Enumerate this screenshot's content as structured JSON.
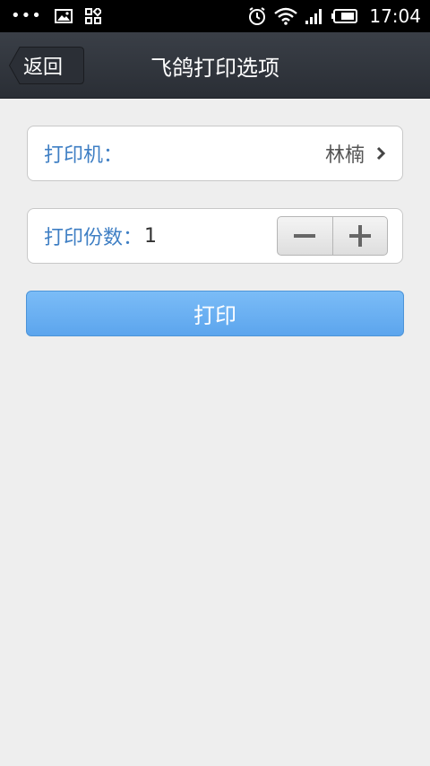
{
  "status_bar": {
    "time": "17:04",
    "left_icons": [
      "more-dots-icon",
      "image-icon",
      "apps-grid-icon"
    ],
    "right_icons": [
      "alarm-icon",
      "wifi-icon",
      "signal-icon",
      "battery-icon"
    ]
  },
  "header": {
    "back_label": "返回",
    "title": "飞鸽打印选项"
  },
  "printer": {
    "label": "打印机：",
    "value": "林楠"
  },
  "copies": {
    "label": "打印份数：",
    "value": "1"
  },
  "print_button": {
    "label": "打印"
  },
  "colors": {
    "title_bar": "#2f333a",
    "label_blue": "#3f7fc4",
    "button_blue": "#6ab1f3",
    "background": "#eeeeee"
  }
}
